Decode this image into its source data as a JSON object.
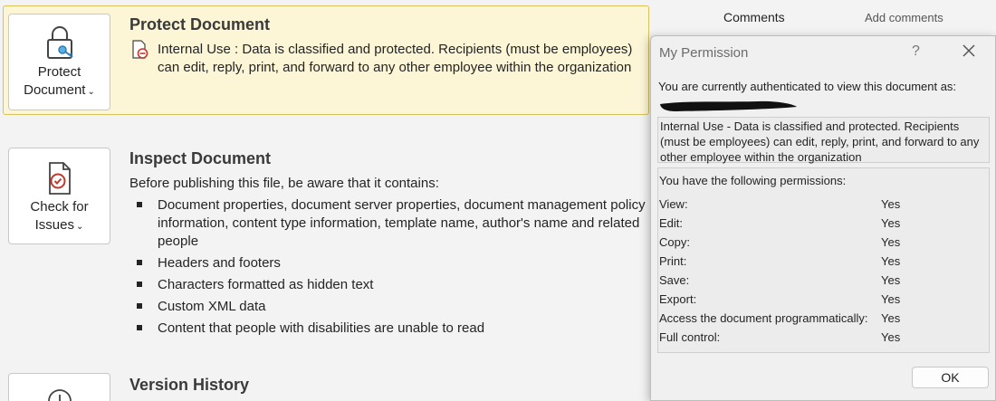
{
  "protect": {
    "button_line1": "Protect",
    "button_line2": "Document",
    "title": "Protect Document",
    "line1": "Internal Use : Data is classified and protected. Recipients (must be employees)",
    "line2": "can edit, reply, print, and forward to any other employee within the organization"
  },
  "inspect": {
    "button_line1": "Check for",
    "button_line2": "Issues",
    "title": "Inspect Document",
    "intro": "Before publishing this file, be aware that it contains:",
    "items": [
      "Document properties, document server properties, document management policy information, content type information, template name, author's name and related people",
      "Headers and footers",
      "Characters formatted as hidden text",
      "Custom XML data",
      "Content that people with disabilities are unable to read"
    ]
  },
  "version": {
    "title": "Version History"
  },
  "properties": {
    "comments_label": "Comments",
    "comments_value": "Add comments"
  },
  "dialog": {
    "title": "My Permission",
    "help": "?",
    "auth_text": "You are currently authenticated to view this document as:",
    "description": "Internal Use - Data is classified and protected. Recipients (must be employees) can edit, reply, print, and forward to any other employee within the organization",
    "perm_heading": "You have the following permissions:",
    "permissions": [
      {
        "label": "View:",
        "value": "Yes"
      },
      {
        "label": "Edit:",
        "value": "Yes"
      },
      {
        "label": "Copy:",
        "value": "Yes"
      },
      {
        "label": "Print:",
        "value": "Yes"
      },
      {
        "label": "Save:",
        "value": "Yes"
      },
      {
        "label": "Export:",
        "value": "Yes"
      },
      {
        "label": "Access the document programmatically:",
        "value": "Yes"
      },
      {
        "label": "Full control:",
        "value": "Yes"
      }
    ],
    "ok_label": "OK"
  }
}
